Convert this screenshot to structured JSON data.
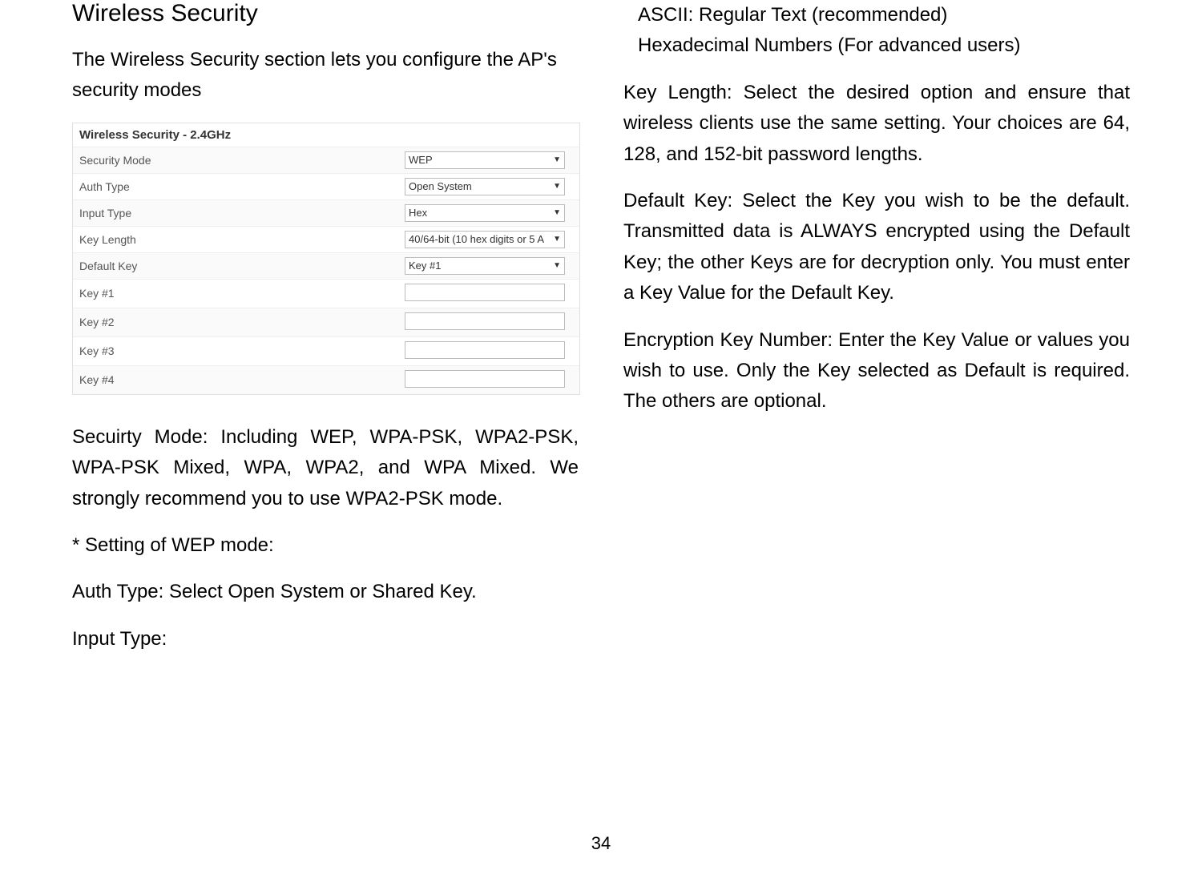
{
  "left": {
    "title": "Wireless Security",
    "intro": "The Wireless Security section lets you configure the AP's security modes",
    "screenshot": {
      "heading": "Wireless Security - 2.4GHz",
      "rows": {
        "sec_mode_label": "Security Mode",
        "sec_mode_value": "WEP",
        "auth_label": "Auth Type",
        "auth_value": "Open System",
        "input_label": "Input Type",
        "input_value": "Hex",
        "keylen_label": "Key Length",
        "keylen_value": "40/64-bit (10 hex digits or 5 A",
        "defkey_label": "Default Key",
        "defkey_value": "Key #1",
        "k1": "Key #1",
        "k2": "Key #2",
        "k3": "Key #3",
        "k4": "Key #4"
      }
    },
    "sec_mode_para": "Secuirty Mode: Including WEP, WPA-PSK, WPA2-PSK, WPA-PSK Mixed, WPA, WPA2, and WPA Mixed. We strongly recommend you to use WPA2-PSK mode.",
    "wep_heading": "* Setting of WEP mode:",
    "auth_para": "Auth Type: Select Open System or Shared Key.",
    "input_type_label": "Input Type:"
  },
  "right": {
    "ascii_line": "ASCII: Regular Text (recommended)",
    "hex_line": "Hexadecimal Numbers (For advanced users)",
    "keylen_para": "Key Length: Select the desired option and ensure that wireless clients use the same setting. Your choices are 64, 128, and 152-bit password lengths.",
    "defkey_para": "Default Key: Select the Key you wish to be the default. Transmitted data is ALWAYS encrypted using the Default Key; the other Keys are for decryption only. You must enter a Key Value for the Default Key.",
    "enc_para": "Encryption Key Number: Enter the Key Value or values you wish to use. Only the Key selected as Default is required. The others are optional."
  },
  "page_number": "34"
}
